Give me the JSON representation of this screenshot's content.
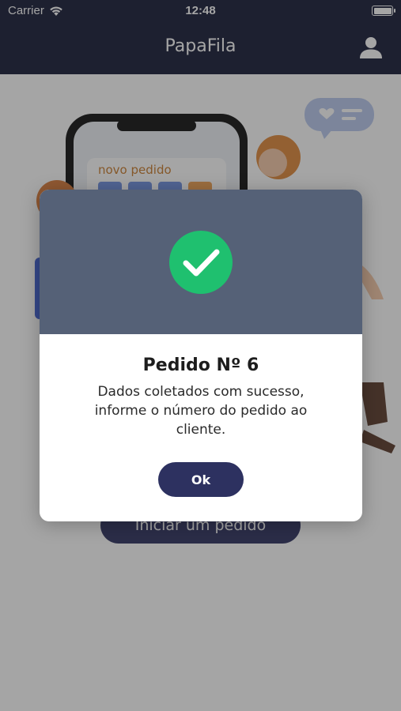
{
  "status_bar": {
    "carrier": "Carrier",
    "time": "12:48",
    "wifi_icon": "wifi-icon",
    "battery_icon": "battery-icon"
  },
  "nav_bar": {
    "title": "PapaFila",
    "profile_icon": "person-icon"
  },
  "illustration": {
    "phone_label": "novo pedido"
  },
  "main": {
    "start_button_label": "Iniciar um pedido"
  },
  "modal": {
    "icon": "check-circle-icon",
    "title": "Pedido Nº 6",
    "message": "Dados coletados com sucesso, informe o número do pedido ao cliente.",
    "ok_label": "Ok"
  },
  "colors": {
    "nav_background": "#161a36",
    "modal_header": "#556177",
    "success_green": "#1fc06f",
    "primary_button": "#2d3160"
  }
}
